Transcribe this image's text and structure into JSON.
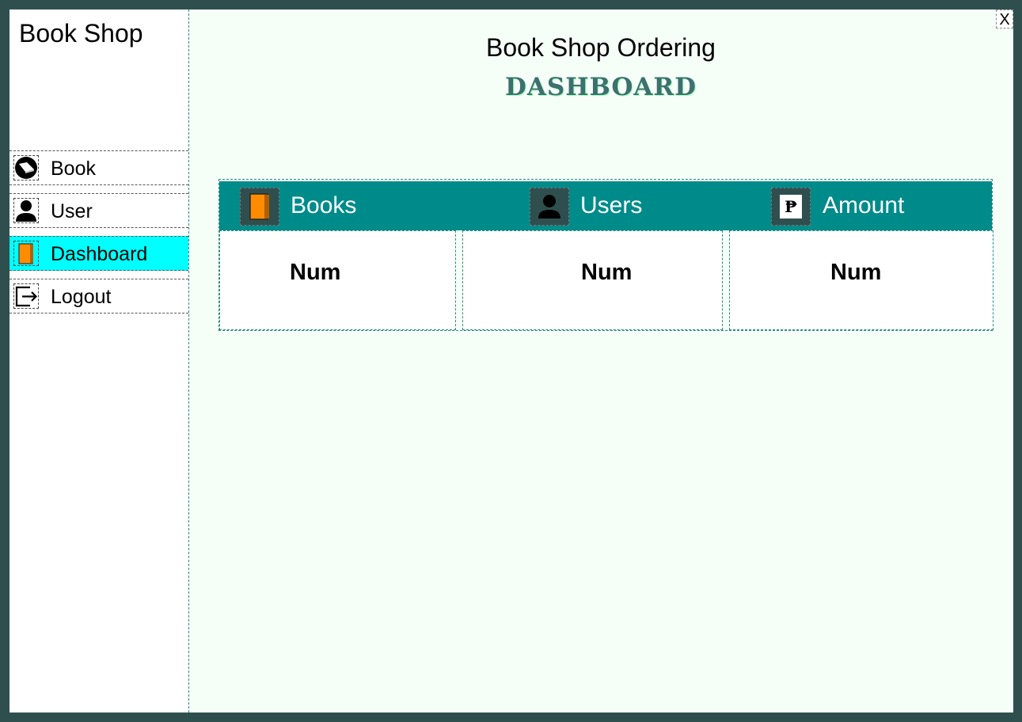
{
  "app": {
    "title": "Book Shop"
  },
  "window": {
    "close_label": "X"
  },
  "sidebar": {
    "items": [
      {
        "label": "Book",
        "icon": "book-icon",
        "active": false
      },
      {
        "label": "User",
        "icon": "user-icon",
        "active": false
      },
      {
        "label": "Dashboard",
        "icon": "dashboard-icon",
        "active": true
      },
      {
        "label": "Logout",
        "icon": "logout-icon",
        "active": false
      }
    ]
  },
  "main": {
    "title": "Book Shop Ordering",
    "subtitle": "DASHBOARD",
    "stats": [
      {
        "label": "Books",
        "icon": "books-icon",
        "value": "Num"
      },
      {
        "label": "Users",
        "icon": "users-icon",
        "value": "Num"
      },
      {
        "label": "Amount",
        "icon": "peso-icon",
        "value": "Num"
      }
    ]
  },
  "colors": {
    "frame": "#2f4f4f",
    "header": "#008b8b",
    "active_nav": "#00ffff",
    "content_bg": "#f5fff8",
    "book_orange": "#ff8c00"
  }
}
